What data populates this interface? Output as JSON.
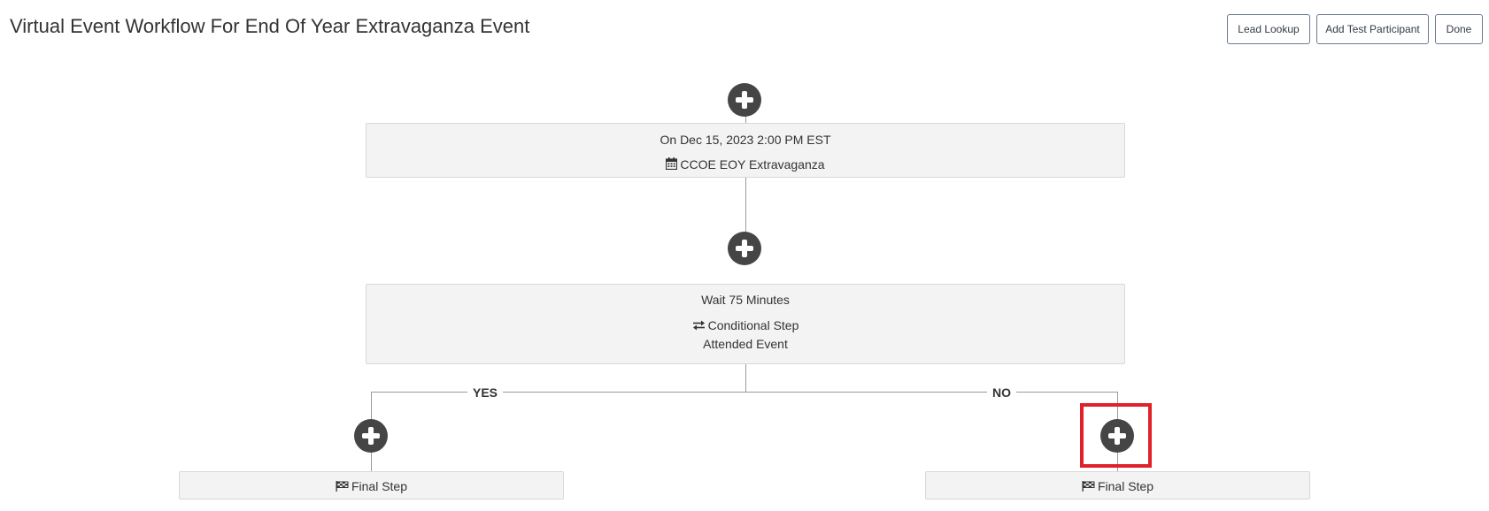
{
  "page": {
    "title": "Virtual Event Workflow For End Of Year Extravaganza Event"
  },
  "toolbar": {
    "lead_lookup_label": "Lead Lookup",
    "add_test_participant_label": "Add Test Participant",
    "done_label": "Done"
  },
  "workflow": {
    "trigger_step": {
      "datetime": "On Dec 15, 2023 2:00 PM EST",
      "event_icon": "calendar-icon",
      "event_name": "CCOE EOY Extravaganza"
    },
    "conditional_step": {
      "wait": "Wait 75 Minutes",
      "type_icon": "exchange-arrows-icon",
      "type_label": "Conditional Step",
      "condition": "Attended Event"
    },
    "branches": {
      "yes": {
        "label": "YES",
        "final_step_icon": "checkered-flag-icon",
        "final_step_label": "Final Step"
      },
      "no": {
        "label": "NO",
        "final_step_icon": "checkered-flag-icon",
        "final_step_label": "Final Step"
      }
    },
    "add_step_icon": "plus-circle-icon",
    "highlight_color": "#e0202a"
  }
}
